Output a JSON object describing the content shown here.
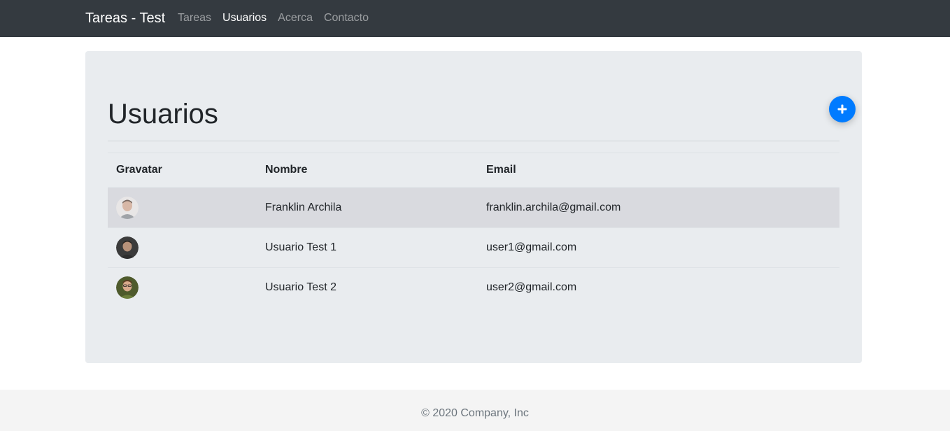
{
  "navbar": {
    "brand": "Tareas - Test",
    "links": [
      {
        "label": "Tareas",
        "active": false
      },
      {
        "label": "Usuarios",
        "active": true
      },
      {
        "label": "Acerca",
        "active": false
      },
      {
        "label": "Contacto",
        "active": false
      }
    ],
    "background": "#343a40"
  },
  "main": {
    "title": "Usuarios",
    "add_button_icon": "plus-icon",
    "accent": "#007bff",
    "table": {
      "headers": [
        "Gravatar",
        "Nombre",
        "Email"
      ],
      "rows": [
        {
          "avatar": "avatar-photo",
          "name": "Franklin Archila",
          "email": "franklin.archila@gmail.com"
        },
        {
          "avatar": "avatar-photo",
          "name": "Usuario Test 1",
          "email": "user1@gmail.com"
        },
        {
          "avatar": "avatar-photo",
          "name": "Usuario Test 2",
          "email": "user2@gmail.com"
        }
      ]
    }
  },
  "footer": {
    "text": "© 2020 Company, Inc"
  }
}
